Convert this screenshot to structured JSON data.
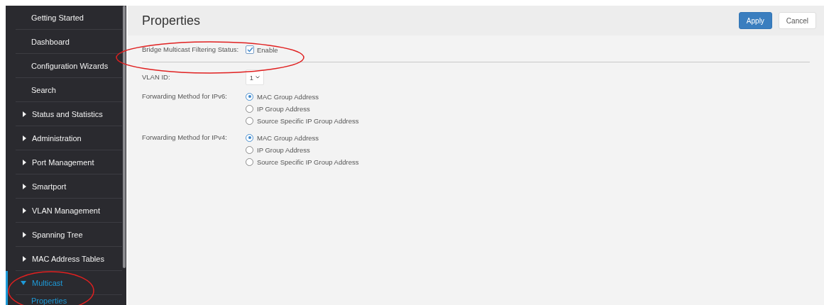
{
  "sidebar": {
    "items": [
      {
        "label": "Getting Started",
        "kind": "link",
        "selected": false
      },
      {
        "label": "Dashboard",
        "kind": "link",
        "selected": false
      },
      {
        "label": "Configuration Wizards",
        "kind": "link",
        "selected": false
      },
      {
        "label": "Search",
        "kind": "link",
        "selected": false
      },
      {
        "label": "Status and Statistics",
        "kind": "group",
        "expanded": false,
        "selected": false
      },
      {
        "label": "Administration",
        "kind": "group",
        "expanded": false,
        "selected": false
      },
      {
        "label": "Port Management",
        "kind": "group",
        "expanded": false,
        "selected": false
      },
      {
        "label": "Smartport",
        "kind": "group",
        "expanded": false,
        "selected": false
      },
      {
        "label": "VLAN Management",
        "kind": "group",
        "expanded": false,
        "selected": false
      },
      {
        "label": "Spanning Tree",
        "kind": "group",
        "expanded": false,
        "selected": false
      },
      {
        "label": "MAC Address Tables",
        "kind": "group",
        "expanded": false,
        "selected": false
      },
      {
        "label": "Multicast",
        "kind": "group",
        "expanded": true,
        "selected": true,
        "children": [
          {
            "label": "Properties",
            "selected": true
          }
        ]
      }
    ]
  },
  "page": {
    "title": "Properties",
    "buttons": [
      {
        "label": "Apply",
        "kind": "primary"
      },
      {
        "label": "Cancel",
        "kind": "secondary"
      }
    ]
  },
  "status": {
    "label": "Bridge Multicast Filtering Status:",
    "option": "Enable",
    "checked": true
  },
  "vlan": {
    "label": "VLAN ID:",
    "value": "1"
  },
  "forwarding": [
    {
      "label": "Forwarding Method for IPv6:",
      "options": [
        {
          "label": "MAC Group Address",
          "selected": true
        },
        {
          "label": "IP Group Address",
          "selected": false
        },
        {
          "label": "Source Specific IP Group Address",
          "selected": false
        }
      ]
    },
    {
      "label": "Forwarding Method for IPv4:",
      "options": [
        {
          "label": "MAC Group Address",
          "selected": true
        },
        {
          "label": "IP Group Address",
          "selected": false
        },
        {
          "label": "Source Specific IP Group Address",
          "selected": false
        }
      ]
    }
  ]
}
